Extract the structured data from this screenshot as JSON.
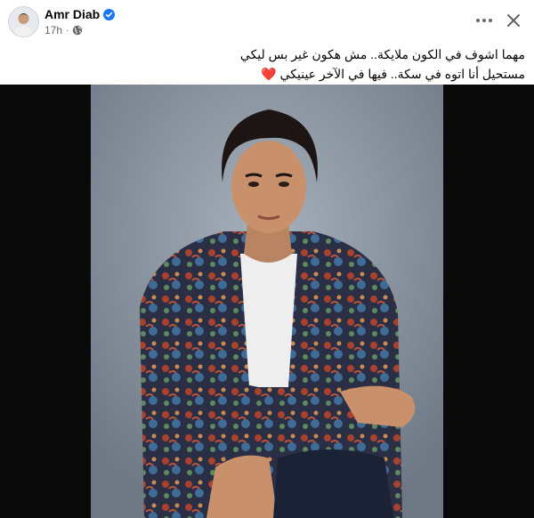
{
  "post": {
    "author_name": "Amr Diab",
    "verified_icon": "verified-badge-icon",
    "timestamp": "17h",
    "privacy_icon": "globe-icon",
    "more_icon": "more-horizontal-icon",
    "close_icon": "close-icon",
    "caption_line1": "مهما اشوف في الكون ملايكة.. مش هكون غير بس ليكي",
    "caption_line2": "مستحيل أنا اتوه في سكة.. فيها في الآخر عينيكي",
    "caption_emoji": "❤️"
  },
  "colors": {
    "verified": "#1877f2",
    "heart": "#e0245e",
    "meta_text": "#65676b",
    "media_bg": "#0a0a0a"
  }
}
